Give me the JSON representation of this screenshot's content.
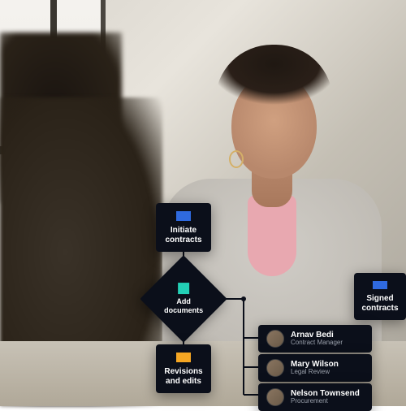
{
  "colors": {
    "node_bg": "#0b0f1a",
    "blue": "#2f6adf",
    "teal": "#23d0b6",
    "amber": "#f5a623"
  },
  "workflow": {
    "initiate": {
      "label": "Initiate\ncontracts",
      "icon_color": "#2f6adf"
    },
    "add_documents": {
      "label": "Add\ndocuments",
      "icon_color": "#23d0b6"
    },
    "revisions": {
      "label": "Revisions\nand edits",
      "icon_color": "#f5a623"
    },
    "signed": {
      "label": "Signed\ncontracts",
      "icon_color": "#2f6adf"
    }
  },
  "people": [
    {
      "name": "Arnav Bedi",
      "role": "Contract Manager"
    },
    {
      "name": "Mary Wilson",
      "role": "Legal Review"
    },
    {
      "name": "Nelson Townsend",
      "role": "Procurement"
    }
  ]
}
